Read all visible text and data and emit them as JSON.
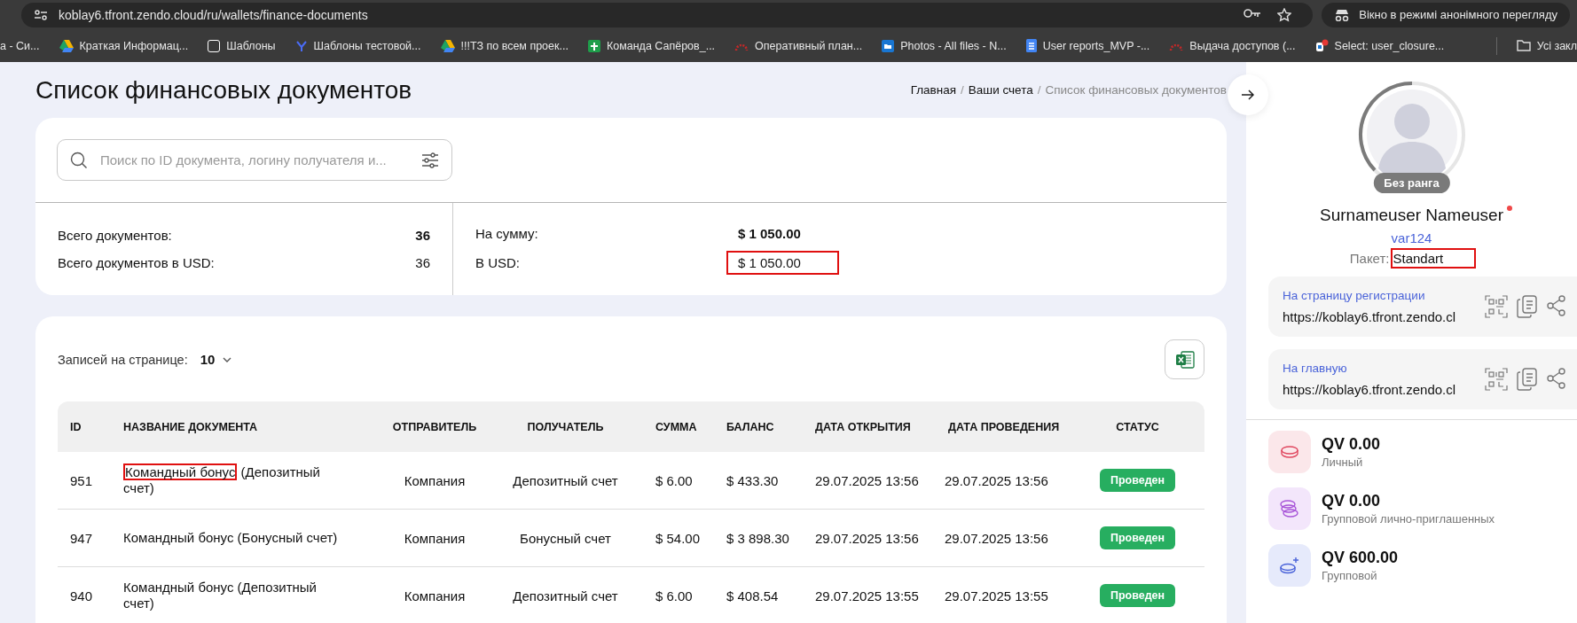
{
  "browser": {
    "url": "koblay6.tfront.zendo.cloud/ru/wallets/finance-documents",
    "incognito_label": "Вікно в режимі анонімного перегляду",
    "bookmarks": [
      {
        "label": "а - Си...",
        "kind": "plain"
      },
      {
        "label": "Краткая Информац...",
        "kind": "drive"
      },
      {
        "label": "Шаблоны",
        "kind": "notion"
      },
      {
        "label": "Шаблоны тестовой...",
        "kind": "letter"
      },
      {
        "label": "!!!ТЗ по всем проек...",
        "kind": "drive"
      },
      {
        "label": "Команда Сапёров_...",
        "kind": "sheet"
      },
      {
        "label": "Оперативный план...",
        "kind": "ring"
      },
      {
        "label": "Photos - All files - N...",
        "kind": "folder"
      },
      {
        "label": "User reports_MVP -...",
        "kind": "doc"
      },
      {
        "label": "Выдача доступов (...",
        "kind": "ring"
      },
      {
        "label": "Select: user_closure...",
        "kind": "db"
      }
    ],
    "all_bookmarks": "Усі закл"
  },
  "page": {
    "title": "Список финансовых документов",
    "breadcrumbs": [
      {
        "label": "Главная",
        "current": false
      },
      {
        "separator": "/",
        "label": "Ваши счета",
        "current": false
      },
      {
        "separator": "/",
        "label": "Список финансовых документов",
        "current": true
      }
    ],
    "search": {
      "placeholder": "Поиск по ID документа, логину получателя и..."
    },
    "stats_left": [
      {
        "label": "Всего документов:",
        "value": "36",
        "bold": true,
        "highlighted": false
      },
      {
        "label": "Всего документов в USD:",
        "value": "36",
        "bold": false,
        "highlighted": false
      }
    ],
    "stats_right": [
      {
        "label": "На сумму:",
        "value": "$ 1 050.00",
        "bold": true,
        "highlighted": false
      },
      {
        "label": "В USD:",
        "value": "$ 1 050.00",
        "bold": false,
        "highlighted": true
      }
    ],
    "per_page": {
      "label": "Записей на странице:",
      "value": "10"
    },
    "table": {
      "columns": [
        "ID",
        "НАЗВАНИЕ ДОКУМЕНТА",
        "ОТПРАВИТЕЛЬ",
        "ПОЛУЧАТЕЛЬ",
        "СУММА",
        "БАЛАНС",
        "ДАТА ОТКРЫТИЯ",
        "ДАТА ПРОВЕДЕНИЯ",
        "СТАТУС"
      ],
      "rows": [
        {
          "id": "951",
          "name": [
            {
              "text": "Командный бонус",
              "highlighted": true
            },
            {
              "text": " (Депозитный счет)",
              "highlighted": false
            }
          ],
          "sender": "Компания",
          "recipient": "Депозитный счет",
          "amount": "$ 6.00",
          "balance": "$ 433.30",
          "opened": "29.07.2025 13:56",
          "posted": "29.07.2025 13:56",
          "status": "Проведен"
        },
        {
          "id": "947",
          "name": [
            {
              "text": "Командный бонус (Бонусный счет)",
              "highlighted": false
            }
          ],
          "sender": "Компания",
          "recipient": "Бонусный счет",
          "amount": "$ 54.00",
          "balance": "$ 3 898.30",
          "opened": "29.07.2025 13:56",
          "posted": "29.07.2025 13:56",
          "status": "Проведен"
        },
        {
          "id": "940",
          "name": [
            {
              "text": "Командный бонус (Депозитный счет)",
              "highlighted": false
            }
          ],
          "sender": "Компания",
          "recipient": "Депозитный счет",
          "amount": "$ 6.00",
          "balance": "$ 408.54",
          "opened": "29.07.2025 13:55",
          "posted": "29.07.2025 13:55",
          "status": "Проведен"
        }
      ]
    }
  },
  "sidebar": {
    "rank": "Без ранга",
    "name": "Surnameuser Nameuser",
    "online": true,
    "login": "var124",
    "package_label": "Пакет:",
    "package": "Standart",
    "package_highlighted": true,
    "links": [
      {
        "label": "На страницу регистрации",
        "url": "https://koblay6.tfront.zendo.cl"
      },
      {
        "label": "На главную",
        "url": "https://koblay6.tfront.zendo.cl"
      }
    ],
    "volumes": [
      {
        "value": "QV 0.00",
        "label": "Личный",
        "color": "#e0475f",
        "kind": "single"
      },
      {
        "value": "QV 0.00",
        "label": "Групповой лично-приглашенных",
        "color": "#a855d8",
        "kind": "stack"
      },
      {
        "value": "QV 600.00",
        "label": "Групповой",
        "color": "#4a63d9",
        "kind": "plus"
      }
    ]
  }
}
